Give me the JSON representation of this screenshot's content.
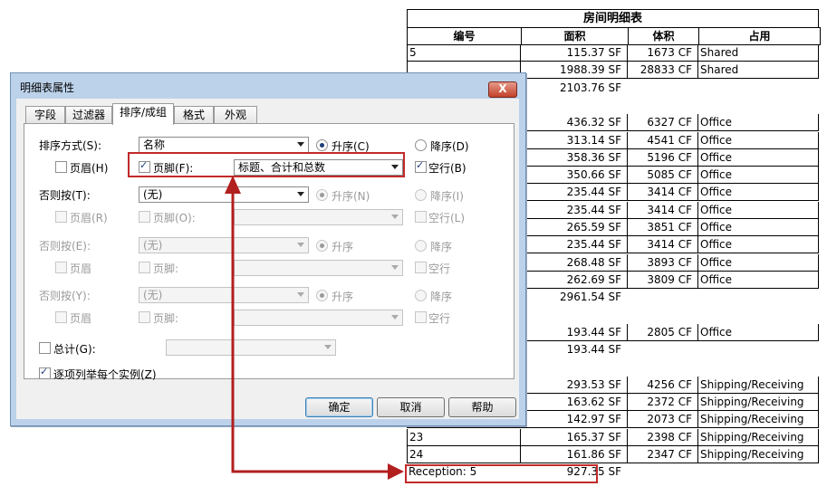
{
  "schedule": {
    "title": "房间明细表",
    "columns": [
      "编号",
      "面积",
      "体积",
      "占用"
    ],
    "rows": [
      {
        "type": "data",
        "num": "5",
        "area": "115.37 SF",
        "volume": "1673 CF",
        "occupancy": "Shared"
      },
      {
        "type": "data",
        "num": "",
        "area": "1988.39 SF",
        "volume": "28833 CF",
        "occupancy": "Shared"
      },
      {
        "type": "total",
        "label": "",
        "area": "2103.76 SF"
      },
      {
        "type": "blank"
      },
      {
        "type": "data",
        "num": "",
        "area": "436.32 SF",
        "volume": "6327 CF",
        "occupancy": "Office"
      },
      {
        "type": "data",
        "num": "",
        "area": "313.14 SF",
        "volume": "4541 CF",
        "occupancy": "Office"
      },
      {
        "type": "data",
        "num": "",
        "area": "358.36 SF",
        "volume": "5196 CF",
        "occupancy": "Office"
      },
      {
        "type": "data",
        "num": "",
        "area": "350.66 SF",
        "volume": "5085 CF",
        "occupancy": "Office"
      },
      {
        "type": "data",
        "num": "",
        "area": "235.44 SF",
        "volume": "3414 CF",
        "occupancy": "Office"
      },
      {
        "type": "data",
        "num": "",
        "area": "235.44 SF",
        "volume": "3414 CF",
        "occupancy": "Office"
      },
      {
        "type": "data",
        "num": "",
        "area": "265.59 SF",
        "volume": "3851 CF",
        "occupancy": "Office"
      },
      {
        "type": "data",
        "num": "",
        "area": "235.44 SF",
        "volume": "3414 CF",
        "occupancy": "Office"
      },
      {
        "type": "data",
        "num": "",
        "area": "268.48 SF",
        "volume": "3893 CF",
        "occupancy": "Office"
      },
      {
        "type": "data",
        "num": "",
        "area": "262.69 SF",
        "volume": "3809 CF",
        "occupancy": "Office"
      },
      {
        "type": "total",
        "label": "",
        "area": "2961.54 SF"
      },
      {
        "type": "blank"
      },
      {
        "type": "data",
        "num": "",
        "area": "193.44 SF",
        "volume": "2805 CF",
        "occupancy": "Office"
      },
      {
        "type": "total",
        "label": "",
        "area": "193.44 SF"
      },
      {
        "type": "blank"
      },
      {
        "type": "data",
        "num": "",
        "area": "293.53 SF",
        "volume": "4256 CF",
        "occupancy": "Shipping/Receiving"
      },
      {
        "type": "data",
        "num": "",
        "area": "163.62 SF",
        "volume": "2372 CF",
        "occupancy": "Shipping/Receiving"
      },
      {
        "type": "data",
        "num": "",
        "area": "142.97 SF",
        "volume": "2073 CF",
        "occupancy": "Shipping/Receiving"
      },
      {
        "type": "data",
        "num": "23",
        "area": "165.37 SF",
        "volume": "2398 CF",
        "occupancy": "Shipping/Receiving"
      },
      {
        "type": "data",
        "num": "24",
        "area": "161.86 SF",
        "volume": "2347 CF",
        "occupancy": "Shipping/Receiving"
      },
      {
        "type": "total",
        "label": "Reception: 5",
        "area": "927.35 SF"
      }
    ]
  },
  "dialog": {
    "title": "明细表属性",
    "close_label": "X",
    "tabs": [
      "字段",
      "过滤器",
      "排序/成组",
      "格式",
      "外观"
    ],
    "active_tab": 2,
    "sort_by": {
      "label": "排序方式(S):",
      "value": "名称",
      "ascending": "升序(C)",
      "descending": "降序(D)",
      "header": "页眉(H)",
      "footer": "页脚(F):",
      "footer_option": "标题、合计和总数",
      "blank_line": "空行(B)"
    },
    "then_by_1": {
      "label": "否则按(T):",
      "value": "(无)",
      "ascending": "升序(N)",
      "descending": "降序(I)",
      "header": "页眉(R)",
      "footer": "页脚(O):",
      "blank_line": "空行(L)"
    },
    "then_by_2": {
      "label": "否则按(E):",
      "value": "(无)",
      "ascending": "升序",
      "descending": "降序",
      "header": "页眉",
      "footer": "页脚:",
      "blank_line": "空行"
    },
    "then_by_3": {
      "label": "否则按(Y):",
      "value": "(无)",
      "ascending": "升序",
      "descending": "降序",
      "header": "页眉",
      "footer": "页脚:",
      "blank_line": "空行"
    },
    "grand_totals": {
      "label": "总计(G):",
      "checked": false
    },
    "itemize": {
      "label": "逐项列举每个实例(Z)",
      "checked": true
    },
    "buttons": {
      "ok": "确定",
      "cancel": "取消",
      "help": "帮助"
    }
  },
  "annotation_color": "#c22a2a"
}
